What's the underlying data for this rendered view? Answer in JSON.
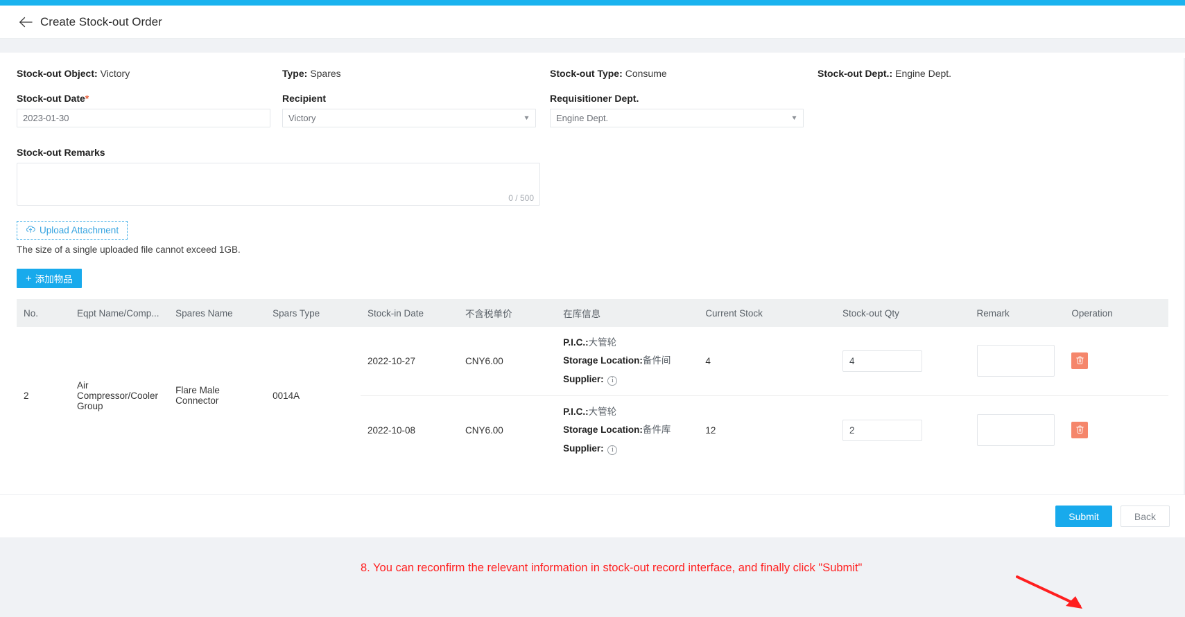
{
  "header": {
    "back_icon": "arrow-left-icon",
    "title": "Create Stock-out Order"
  },
  "summary": [
    {
      "label": "Stock-out Object:",
      "value": "Victory"
    },
    {
      "label": "Type:",
      "value": "Spares"
    },
    {
      "label": "Stock-out Type:",
      "value": "Consume"
    },
    {
      "label": "Stock-out Dept.:",
      "value": "Engine Dept."
    }
  ],
  "fields": {
    "stock_out_date": {
      "label": "Stock-out Date",
      "required_mark": "*",
      "value": "2023-01-30"
    },
    "recipient": {
      "label": "Recipient",
      "value": "Victory",
      "caret": "▼"
    },
    "requisitioner_dept": {
      "label": "Requisitioner Dept.",
      "value": "Engine Dept.",
      "caret": "▼"
    }
  },
  "remarks": {
    "label": "Stock-out Remarks",
    "value": "",
    "counter": "0 / 500"
  },
  "upload": {
    "button_label": "Upload Attachment",
    "icon": "cloud-upload-icon",
    "hint": "The size of a single uploaded file cannot exceed 1GB."
  },
  "add_item_button": {
    "plus": "+",
    "label": "添加物品"
  },
  "table": {
    "columns": [
      "No.",
      "Eqpt Name/Comp...",
      "Spares Name",
      "Spars Type",
      "Stock-in Date",
      "不含税单价",
      "在库信息",
      "Current Stock",
      "Stock-out Qty",
      "Remark",
      "Operation"
    ],
    "group": {
      "no": "2",
      "eqpt_name": "Air Compressor/Cooler Group",
      "spares_name": "Flare Male Connector",
      "spars_type": "0014A"
    },
    "rows": [
      {
        "stock_in_date": "2022-10-27",
        "unit_price": "CNY6.00",
        "pic_label": "P.I.C.:",
        "pic_value": "大管轮",
        "storage_label": "Storage Location:",
        "storage_value": "备件间",
        "supplier_label": "Supplier:",
        "supplier_icon": "info-circle-icon",
        "current_stock": "4",
        "stock_out_qty": "4",
        "remark": "",
        "delete_icon": "trash-icon"
      },
      {
        "stock_in_date": "2022-10-08",
        "unit_price": "CNY6.00",
        "pic_label": "P.I.C.:",
        "pic_value": "大管轮",
        "storage_label": "Storage Location:",
        "storage_value": "备件库",
        "supplier_label": "Supplier:",
        "supplier_icon": "info-circle-icon",
        "current_stock": "12",
        "stock_out_qty": "2",
        "remark": "",
        "delete_icon": "trash-icon"
      }
    ]
  },
  "annotation": {
    "text": "8. You can reconfirm the relevant information in stock-out record interface, and finally click \"Submit\"",
    "color": "#ff1f1f"
  },
  "footer": {
    "submit_label": "Submit",
    "back_label": "Back"
  },
  "colors": {
    "accent": "#18aaec",
    "top_strip": "#1ab3ef",
    "danger": "#f5866b",
    "annotation_red": "#ff1f1f",
    "required_star": "#e8603c"
  }
}
